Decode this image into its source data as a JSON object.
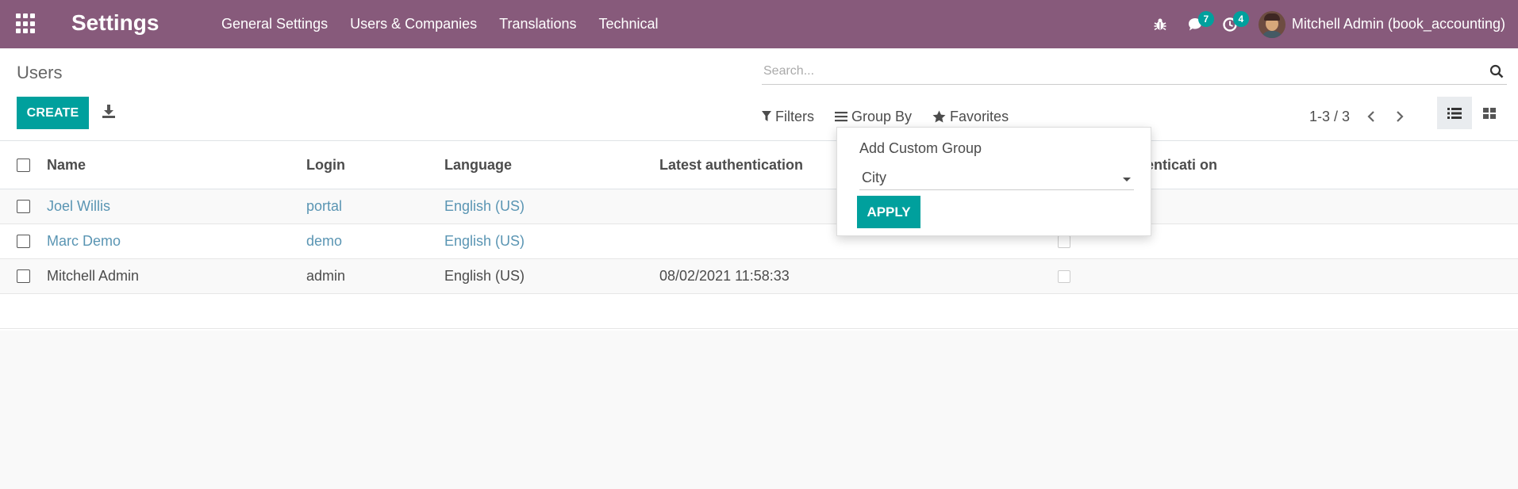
{
  "navbar": {
    "app_title": "Settings",
    "menu": [
      "General Settings",
      "Users & Companies",
      "Translations",
      "Technical"
    ],
    "messages_count": "7",
    "activities_count": "4",
    "user_name": "Mitchell Admin (book_accounting)"
  },
  "control_panel": {
    "breadcrumb": "Users",
    "create_label": "CREATE",
    "search_placeholder": "Search...",
    "filters_label": "Filters",
    "group_by_label": "Group By",
    "favorites_label": "Favorites",
    "pager": "1-3 / 3"
  },
  "table": {
    "columns": [
      "Name",
      "Login",
      "Language",
      "Latest authentication",
      "henticati on"
    ],
    "rows": [
      {
        "name": "Joel Willis",
        "login": "portal",
        "language": "English (US)",
        "latest_auth": ""
      },
      {
        "name": "Marc Demo",
        "login": "demo",
        "language": "English (US)",
        "latest_auth": ""
      },
      {
        "name": "Mitchell Admin",
        "login": "admin",
        "language": "English (US)",
        "latest_auth": "08/02/2021 11:58:33"
      }
    ]
  },
  "group_by_dropdown": {
    "title": "Add Custom Group",
    "selected": "City",
    "apply_label": "APPLY"
  },
  "colors": {
    "navbar": "#875a7b",
    "primary": "#00a09d",
    "link": "#5a95b3"
  }
}
